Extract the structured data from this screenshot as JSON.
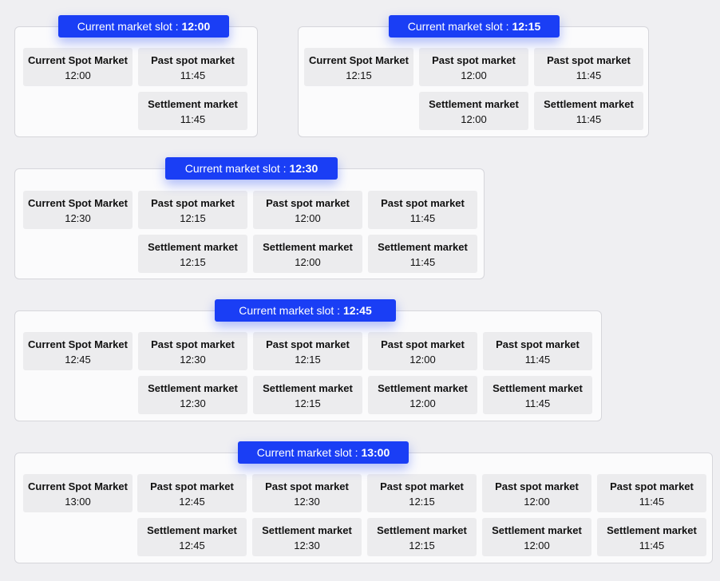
{
  "slot_prefix": "Current market slot : ",
  "current_title": "Current Spot Market",
  "past_title": "Past spot market",
  "settlement_title": "Settlement market",
  "slots": [
    {
      "time": "12:00",
      "past": [
        "11:45"
      ],
      "settlement": [
        "11:45"
      ]
    },
    {
      "time": "12:15",
      "past": [
        "12:00",
        "11:45"
      ],
      "settlement": [
        "12:00",
        "11:45"
      ]
    },
    {
      "time": "12:30",
      "past": [
        "12:15",
        "12:00",
        "11:45"
      ],
      "settlement": [
        "12:15",
        "12:00",
        "11:45"
      ]
    },
    {
      "time": "12:45",
      "past": [
        "12:30",
        "12:15",
        "12:00",
        "11:45"
      ],
      "settlement": [
        "12:30",
        "12:15",
        "12:00",
        "11:45"
      ]
    },
    {
      "time": "13:00",
      "past": [
        "12:45",
        "12:30",
        "12:15",
        "12:00",
        "11:45"
      ],
      "settlement": [
        "12:45",
        "12:30",
        "12:15",
        "12:00",
        "11:45"
      ]
    }
  ]
}
